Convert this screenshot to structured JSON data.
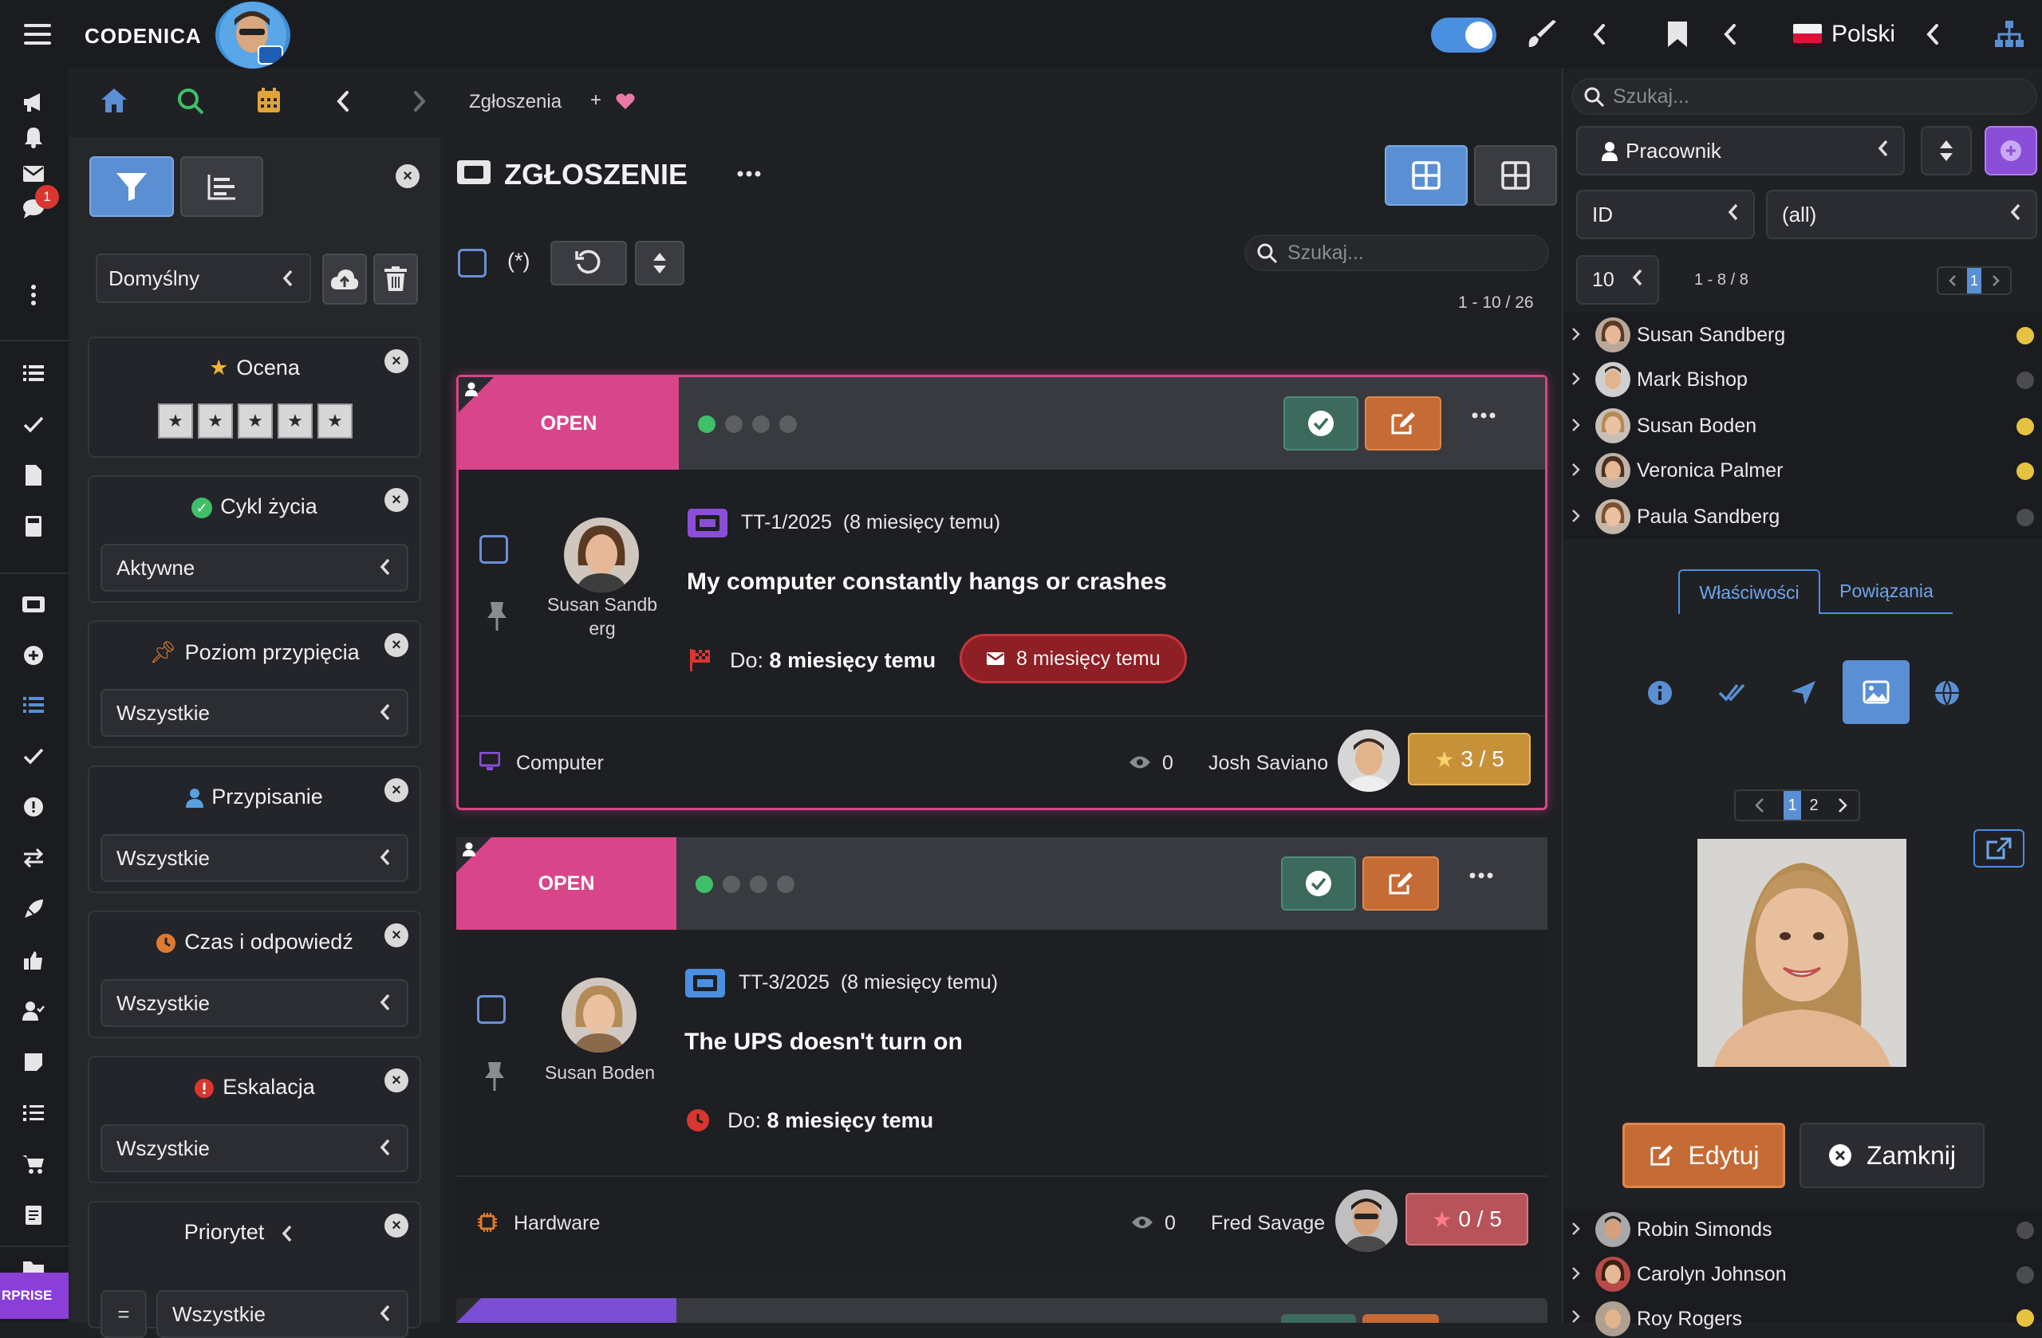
{
  "app": {
    "brand": "CODENICA"
  },
  "topbar": {
    "language": "Polski"
  },
  "colors": {
    "accent": "#4a8fe0",
    "status_open": "#d9458a",
    "ok_green": "#3fbf6a",
    "edit_orange": "#c56b36",
    "online_yellow": "#e5c340"
  },
  "rail": {
    "badge_count": "1",
    "enterprise_label": "RPRISE"
  },
  "breadcrumb": {
    "current": "Zgłoszenia",
    "add": "+"
  },
  "filters": {
    "preset": "Domyślny",
    "rating": {
      "title": "Ocena",
      "stars": [
        "★",
        "★",
        "★",
        "★",
        "★"
      ]
    },
    "lifecycle": {
      "title": "Cykl życia",
      "value": "Aktywne"
    },
    "pin_level": {
      "title": "Poziom przypięcia",
      "value": "Wszystkie"
    },
    "assignment": {
      "title": "Przypisanie",
      "value": "Wszystkie"
    },
    "response_time": {
      "title": "Czas i odpowiedź",
      "value": "Wszystkie"
    },
    "escalation": {
      "title": "Eskalacja",
      "value": "Wszystkie"
    },
    "priority": {
      "title": "Priorytet",
      "value": "Wszystkie"
    }
  },
  "main": {
    "title": "ZGŁOSZENIE",
    "wildcard": "(*)",
    "search_placeholder": "Szukaj...",
    "pagination": "1 - 10 / 26",
    "tickets": [
      {
        "status": "OPEN",
        "progress_step": 1,
        "progress_total": 4,
        "id": "TT-1/2025",
        "age": "(8 miesięcy temu)",
        "title": "My computer constantly hangs or crashes",
        "due_label": "Do:",
        "due": "8 miesięcy temu",
        "mail": "8 miesięcy temu",
        "requester": "Susan Sandb erg",
        "category": "Computer",
        "views": "0",
        "assignee": "Josh Saviano",
        "rating": "3 / 5"
      },
      {
        "status": "OPEN",
        "progress_step": 1,
        "progress_total": 4,
        "id": "TT-3/2025",
        "age": "(8 miesięcy temu)",
        "title": "The UPS doesn't turn on",
        "due_label": "Do:",
        "due": "8 miesięcy temu",
        "requester": "Susan Boden",
        "category": "Hardware",
        "views": "0",
        "assignee": "Fred Savage",
        "rating": "0 / 5"
      }
    ]
  },
  "right": {
    "search_placeholder": "Szukaj...",
    "entity": "Pracownik",
    "field": "ID",
    "field_value": "(all)",
    "page_size": "10",
    "range": "1 - 8 / 8",
    "page": "1",
    "people_top": [
      {
        "name": "Susan Sandberg",
        "status": "#e5c340"
      },
      {
        "name": "Mark Bishop",
        "status": "#4a4c51"
      },
      {
        "name": "Susan Boden",
        "status": "#e5c340"
      },
      {
        "name": "Veronica Palmer",
        "status": "#e5c340"
      },
      {
        "name": "Paula Sandberg",
        "status": "#4a4c51"
      }
    ],
    "tabs": {
      "properties": "Właściwości",
      "relations": "Powiązania"
    },
    "image_pages": [
      "1",
      "2"
    ],
    "edit": "Edytuj",
    "close": "Zamknij",
    "people_bottom": [
      {
        "name": "Robin Simonds",
        "status": "#4a4c51"
      },
      {
        "name": "Carolyn Johnson",
        "status": "#4a4c51"
      },
      {
        "name": "Roy Rogers",
        "status": "#e5c340"
      }
    ]
  }
}
